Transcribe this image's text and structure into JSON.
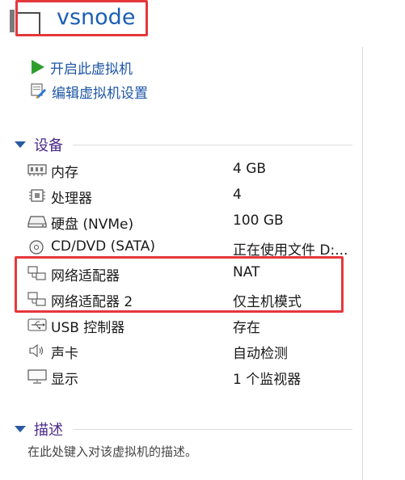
{
  "header": {
    "vm_name": "vsnode"
  },
  "actions": [
    {
      "label": "开启此虚拟机",
      "icon": "play-icon"
    },
    {
      "label": "编辑虚拟机设置",
      "icon": "edit-settings-icon"
    }
  ],
  "devices": {
    "title": "设备",
    "items": [
      {
        "name": "内存",
        "value": "4 GB",
        "icon": "memory-icon"
      },
      {
        "name": "处理器",
        "value": "4",
        "icon": "cpu-icon"
      },
      {
        "name": "硬盘 (NVMe)",
        "value": "100 GB",
        "icon": "hard-disk-icon"
      },
      {
        "name": "CD/DVD (SATA)",
        "value": "正在使用文件 D:...",
        "icon": "cd-dvd-icon"
      },
      {
        "name": "网络适配器",
        "value": "NAT",
        "icon": "network-adapter-icon"
      },
      {
        "name": "网络适配器 2",
        "value": "仅主机模式",
        "icon": "network-adapter-icon"
      },
      {
        "name": "USB 控制器",
        "value": "存在",
        "icon": "usb-icon"
      },
      {
        "name": "声卡",
        "value": "自动检测",
        "icon": "speaker-icon"
      },
      {
        "name": "显示",
        "value": "1 个监视器",
        "icon": "monitor-icon"
      }
    ]
  },
  "description": {
    "title": "描述",
    "placeholder": "在此处键入对该虚拟机的描述。"
  },
  "colors": {
    "highlight": "#e5383b",
    "link": "#1f57a7",
    "title": "#1a5fb4"
  }
}
